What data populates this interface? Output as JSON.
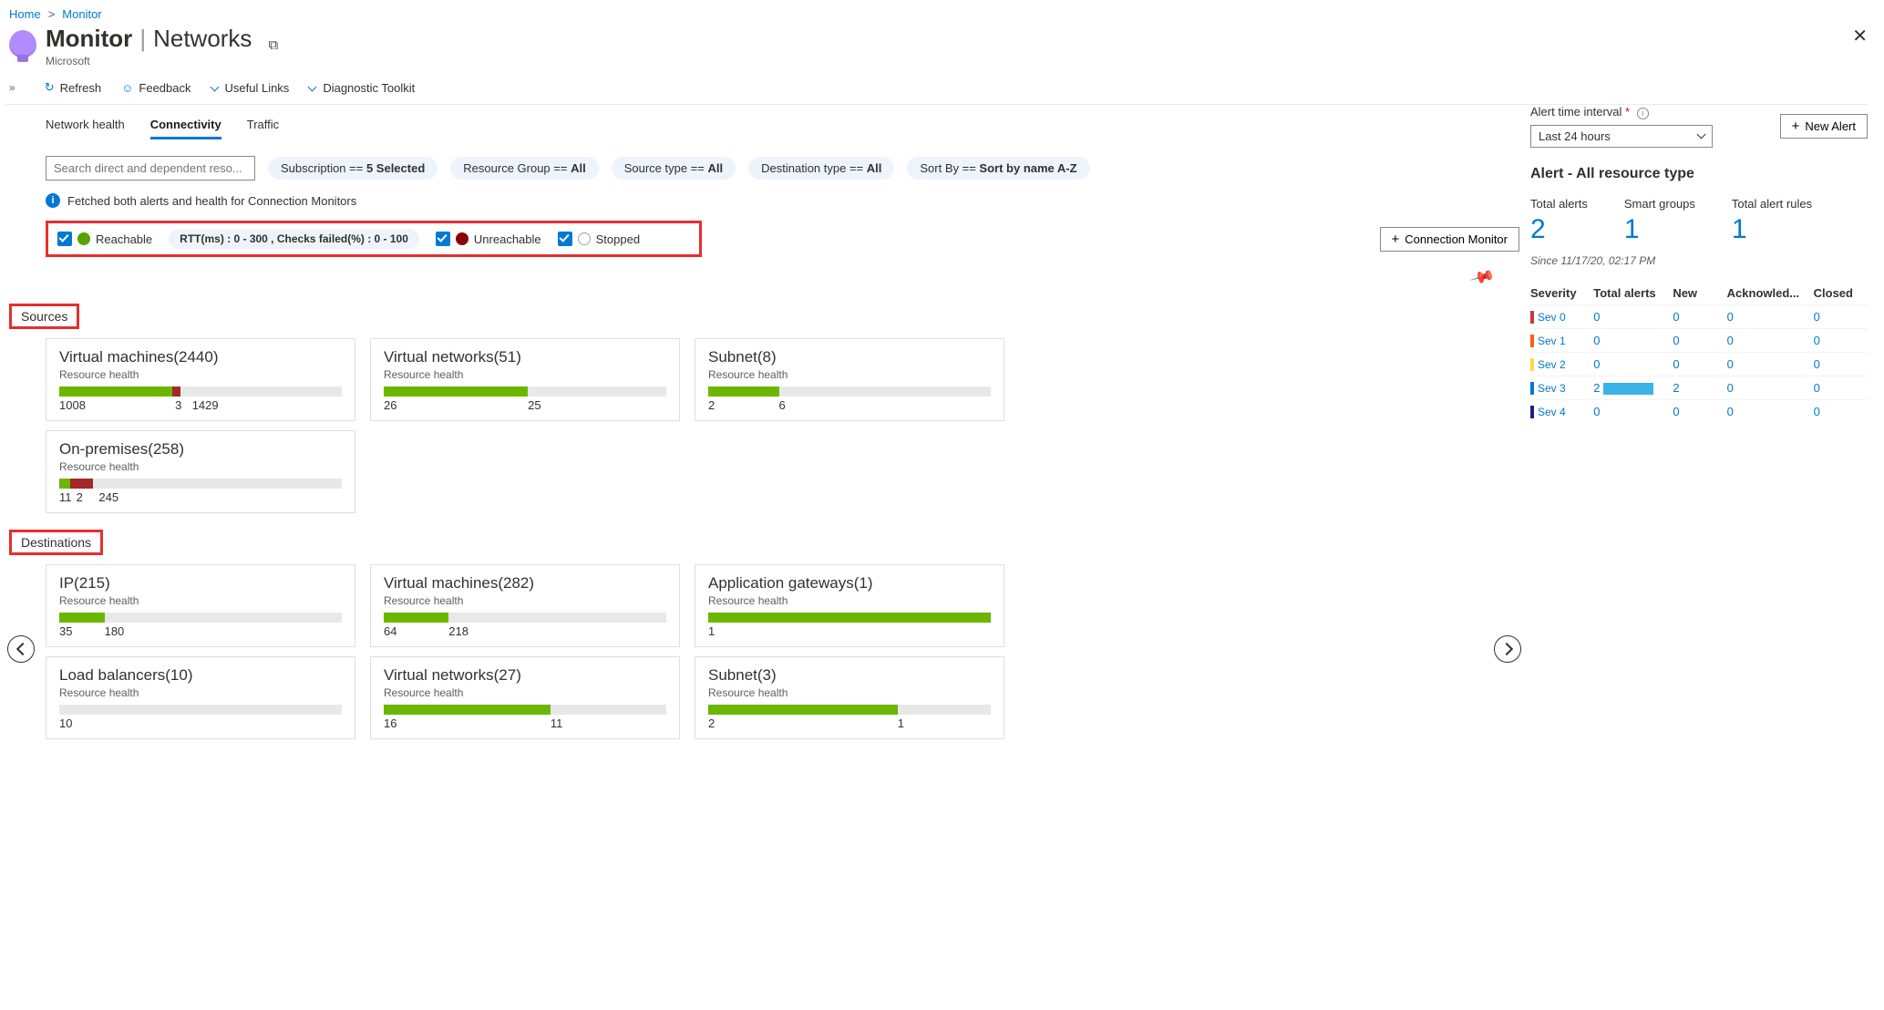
{
  "breadcrumb": {
    "home": "Home",
    "monitor": "Monitor"
  },
  "header": {
    "title": "Monitor",
    "section": "Networks",
    "org": "Microsoft"
  },
  "toolbar": {
    "refresh": "Refresh",
    "feedback": "Feedback",
    "useful_links": "Useful Links",
    "diagnostic": "Diagnostic Toolkit"
  },
  "tabs": {
    "health": "Network health",
    "connectivity": "Connectivity",
    "traffic": "Traffic"
  },
  "filters": {
    "search_placeholder": "Search direct and dependent reso...",
    "subscription_label": "Subscription == ",
    "subscription_value": "5 Selected",
    "rg_label": "Resource Group == ",
    "rg_value": "All",
    "src_label": "Source type == ",
    "src_value": "All",
    "dst_label": "Destination type == ",
    "dst_value": "All",
    "sort_label": "Sort By == ",
    "sort_value": "Sort by name A-Z"
  },
  "info_msg": "Fetched both alerts and health for Connection Monitors",
  "legend": {
    "reachable": "Reachable",
    "params": "RTT(ms) : 0 - 300 , Checks failed(%) : 0 - 100",
    "unreachable": "Unreachable",
    "stopped": "Stopped",
    "new_button": "Connection Monitor"
  },
  "sections": {
    "sources": "Sources",
    "destinations": "Destinations"
  },
  "resource_health_label": "Resource health",
  "sources": [
    {
      "title": "Virtual machines(2440)",
      "seg_g": 40,
      "seg_r": 3,
      "vals": [
        "1008",
        "3",
        "1429"
      ],
      "pos": [
        0,
        41,
        47
      ]
    },
    {
      "title": "Virtual networks(51)",
      "seg_g": 51,
      "seg_r": 0,
      "vals": [
        "26",
        "25"
      ],
      "pos": [
        0,
        51
      ]
    },
    {
      "title": "Subnet(8)",
      "seg_g": 25,
      "seg_r": 0,
      "vals": [
        "2",
        "6"
      ],
      "pos": [
        0,
        25
      ]
    },
    {
      "title": "On-premises(258)",
      "seg_g": 4,
      "seg_r": 8,
      "vals": [
        "11",
        "2",
        "245"
      ],
      "pos": [
        0,
        6,
        14
      ]
    }
  ],
  "destinations": [
    {
      "title": "IP(215)",
      "seg_g": 16,
      "seg_r": 0,
      "vals": [
        "35",
        "180"
      ],
      "pos": [
        0,
        16
      ]
    },
    {
      "title": "Virtual machines(282)",
      "seg_g": 23,
      "seg_r": 0,
      "vals": [
        "64",
        "218"
      ],
      "pos": [
        0,
        23
      ]
    },
    {
      "title": "Application gateways(1)",
      "seg_g": 100,
      "seg_r": 0,
      "vals": [
        "1"
      ],
      "pos": [
        0
      ]
    },
    {
      "title": "Load balancers(10)",
      "seg_g": 0,
      "seg_r": 0,
      "vals": [
        "10"
      ],
      "pos": [
        0
      ]
    },
    {
      "title": "Virtual networks(27)",
      "seg_g": 59,
      "seg_r": 0,
      "vals": [
        "16",
        "11"
      ],
      "pos": [
        0,
        59
      ]
    },
    {
      "title": "Subnet(3)",
      "seg_g": 67,
      "seg_r": 0,
      "vals": [
        "2",
        "1"
      ],
      "pos": [
        0,
        67
      ]
    }
  ],
  "right": {
    "interval_label": "Alert time interval",
    "interval_value": "Last 24 hours",
    "new_alert": "New Alert",
    "alert_header": "Alert - All resource type",
    "kpi_total_label": "Total alerts",
    "kpi_total_val": "2",
    "kpi_smart_label": "Smart groups",
    "kpi_smart_val": "1",
    "kpi_rules_label": "Total alert rules",
    "kpi_rules_val": "1",
    "since": "Since 11/17/20, 02:17 PM",
    "cols": {
      "sev": "Severity",
      "ta": "Total alerts",
      "new": "New",
      "ack": "Acknowled...",
      "cl": "Closed"
    },
    "rows": [
      {
        "name": "Sev 0",
        "cls": "sev0",
        "ta": "0",
        "new": "0",
        "ack": "0",
        "cl": "0"
      },
      {
        "name": "Sev 1",
        "cls": "sev1",
        "ta": "0",
        "new": "0",
        "ack": "0",
        "cl": "0"
      },
      {
        "name": "Sev 2",
        "cls": "sev2",
        "ta": "0",
        "new": "0",
        "ack": "0",
        "cl": "0"
      },
      {
        "name": "Sev 3",
        "cls": "sev3",
        "ta": "2",
        "new": "2",
        "ack": "0",
        "cl": "0",
        "spark": true
      },
      {
        "name": "Sev 4",
        "cls": "sev4",
        "ta": "0",
        "new": "0",
        "ack": "0",
        "cl": "0"
      }
    ]
  }
}
